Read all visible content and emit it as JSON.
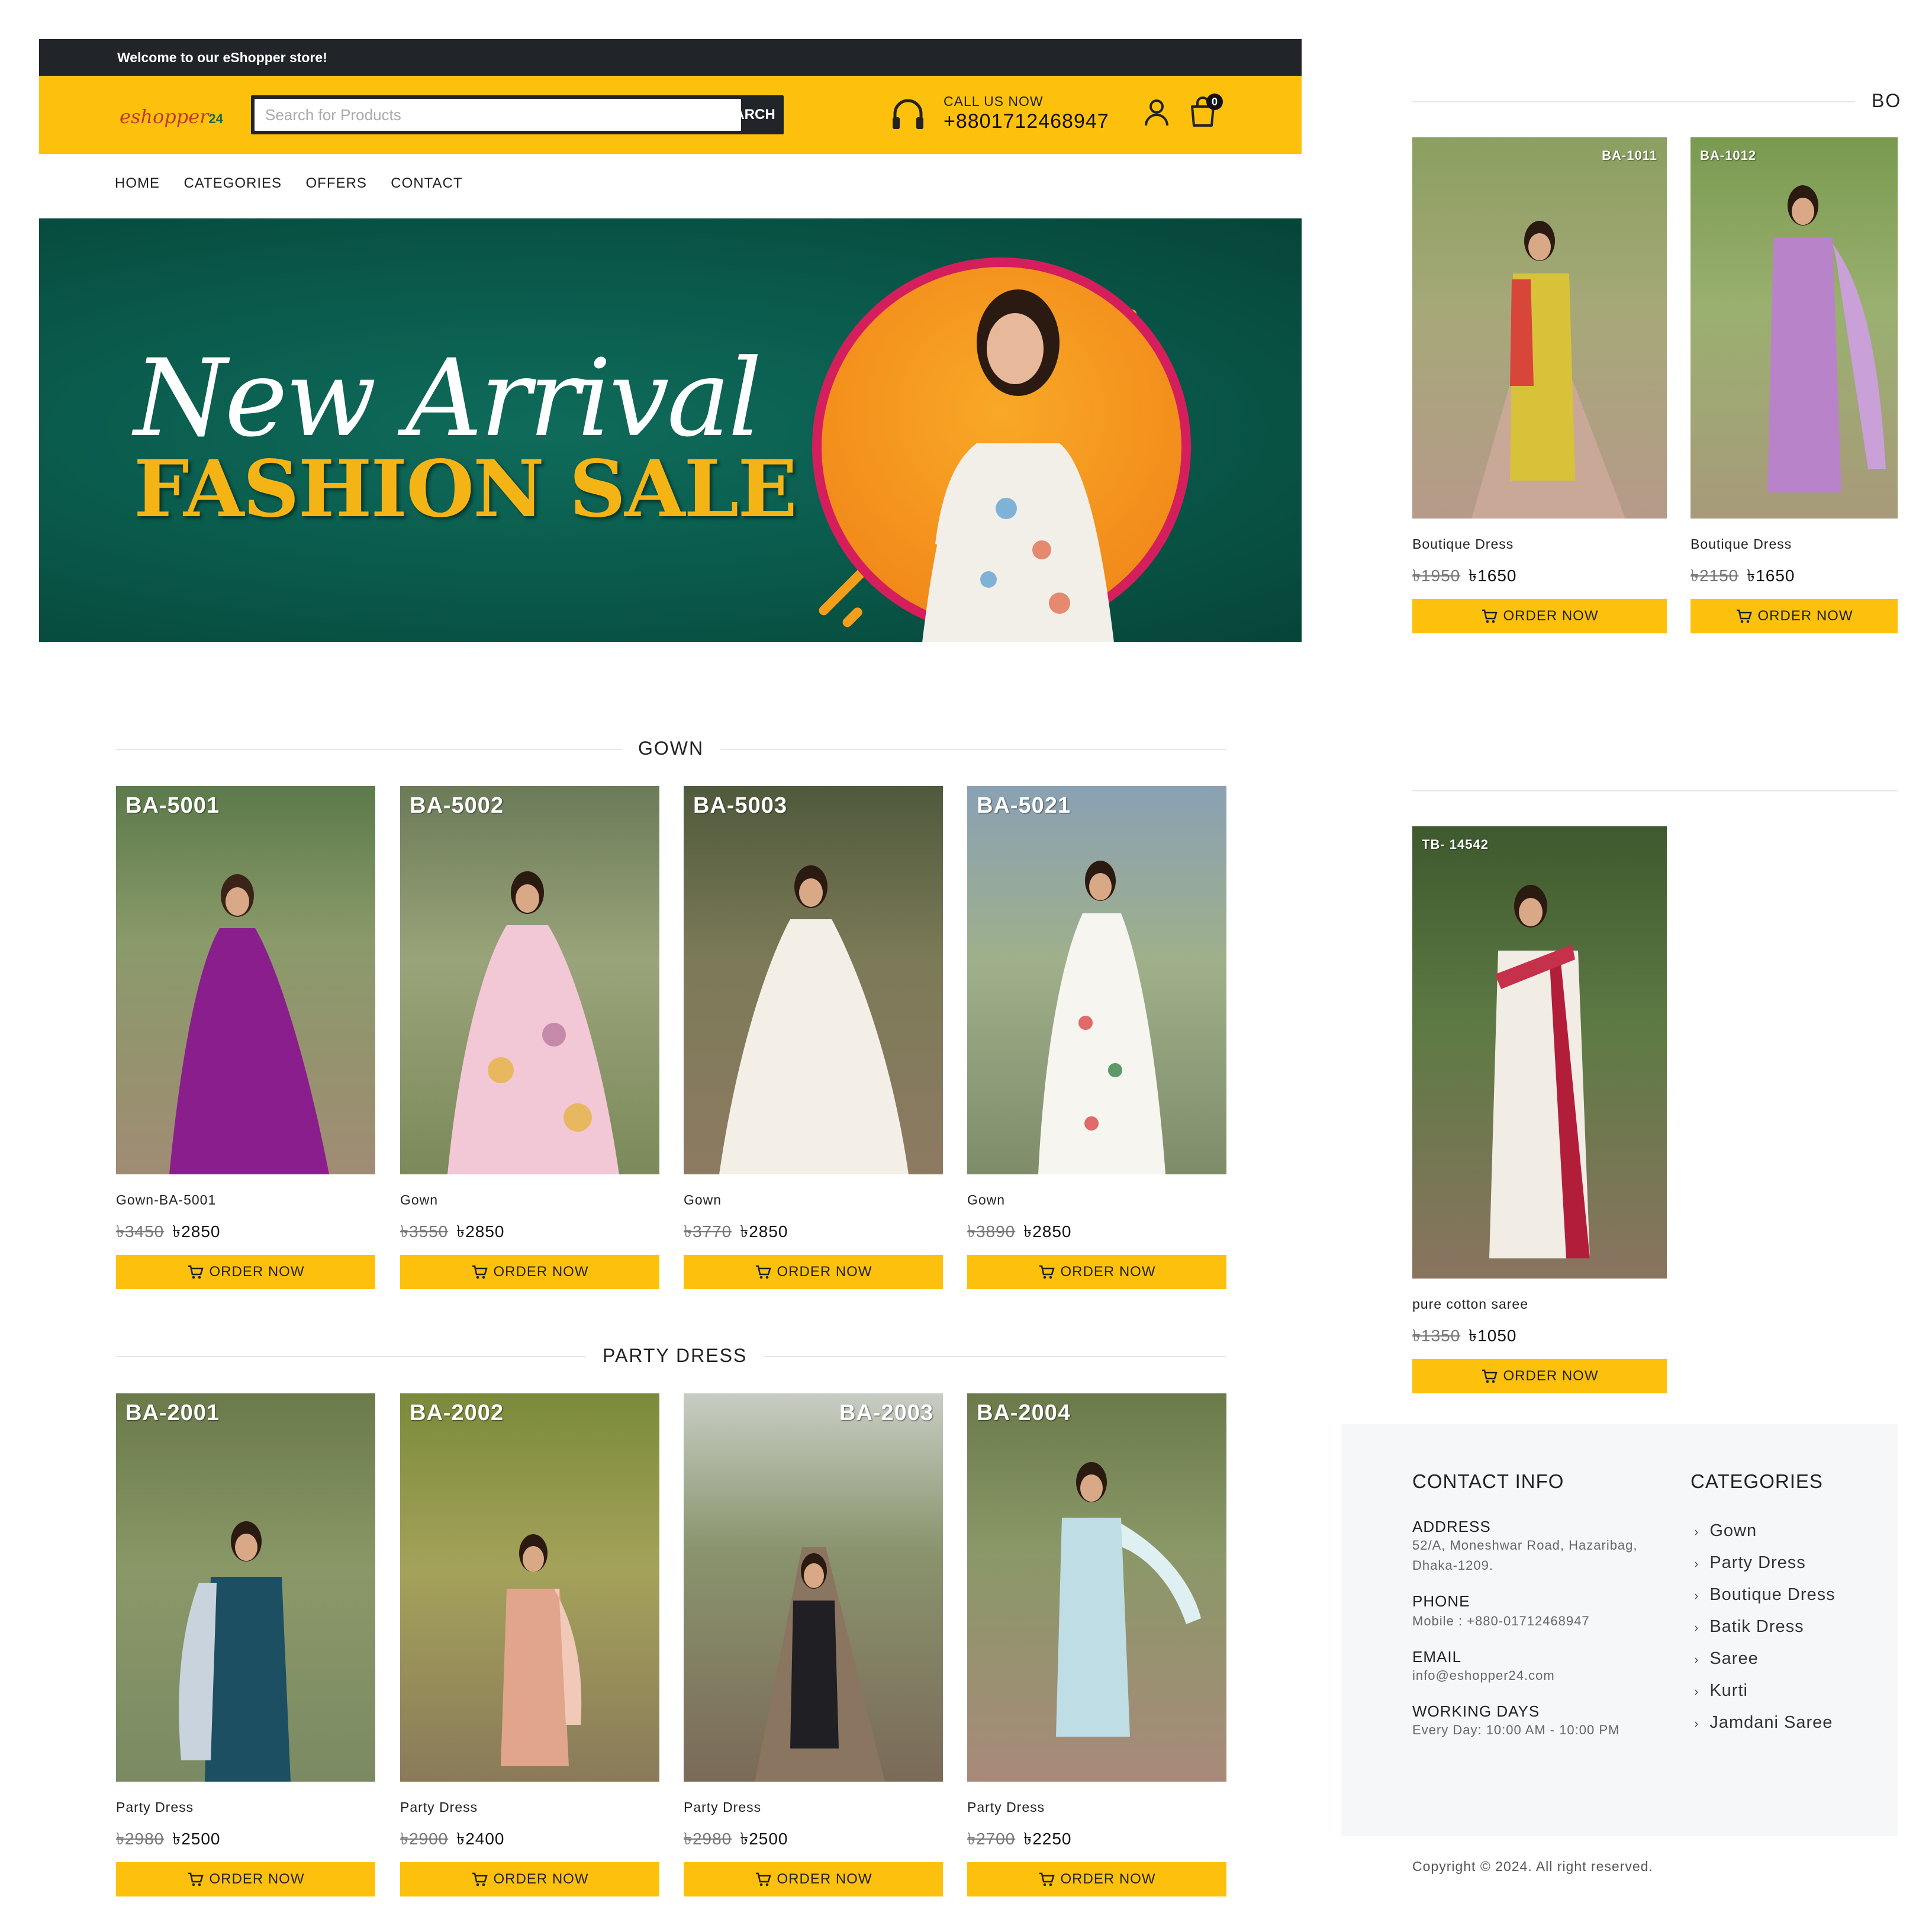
{
  "topbar": {
    "welcome": "Welcome to our eShopper store!"
  },
  "header": {
    "logo_text": "eshopper",
    "logo_suffix": "24",
    "search_placeholder": "Search for Products",
    "search_button": "SEARCH",
    "call_label": "CALL US NOW",
    "call_number": "+8801712468947",
    "cart_count": "0"
  },
  "nav": {
    "items": [
      "HOME",
      "CATEGORIES",
      "OFFERS",
      "CONTACT"
    ]
  },
  "banner": {
    "script_text": "New Arrival",
    "sale_text": "FASHION SALE"
  },
  "gown": {
    "title": "GOWN",
    "products": [
      {
        "code": "BA-5001",
        "name": "Gown-BA-5001",
        "old_price": "৳3450",
        "new_price": "৳2850",
        "button": "ORDER NOW"
      },
      {
        "code": "BA-5002",
        "name": "Gown",
        "old_price": "৳3550",
        "new_price": "৳2850",
        "button": "ORDER NOW"
      },
      {
        "code": "BA-5003",
        "name": "Gown",
        "old_price": "৳3770",
        "new_price": "৳2850",
        "button": "ORDER NOW"
      },
      {
        "code": "BA-5021",
        "name": "Gown",
        "old_price": "৳3890",
        "new_price": "৳2850",
        "button": "ORDER NOW"
      }
    ]
  },
  "party": {
    "title": "PARTY DRESS",
    "products": [
      {
        "code": "BA-2001",
        "name": "Party Dress",
        "old_price": "৳2980",
        "new_price": "৳2500",
        "button": "ORDER NOW"
      },
      {
        "code": "BA-2002",
        "name": "Party Dress",
        "old_price": "৳2900",
        "new_price": "৳2400",
        "button": "ORDER NOW"
      },
      {
        "code": "BA-2003",
        "name": "Party Dress",
        "old_price": "৳2980",
        "new_price": "৳2500",
        "button": "ORDER NOW"
      },
      {
        "code": "BA-2004",
        "name": "Party Dress",
        "old_price": "৳2700",
        "new_price": "৳2250",
        "button": "ORDER NOW"
      }
    ]
  },
  "boutique": {
    "title": "BO",
    "products": [
      {
        "code": "BA-1011",
        "name": "Boutique Dress",
        "old_price": "৳1950",
        "new_price": "৳1650",
        "button": "ORDER NOW"
      },
      {
        "code": "BA-1012",
        "name": "Boutique Dress",
        "old_price": "৳2150",
        "new_price": "৳1650",
        "button": "ORDER NOW"
      }
    ]
  },
  "saree": {
    "products": [
      {
        "code": "TB- 14542",
        "name": "pure cotton saree",
        "old_price": "৳1350",
        "new_price": "৳1050",
        "button": "ORDER NOW"
      }
    ]
  },
  "footer": {
    "contact_title": "CONTACT INFO",
    "address_label": "ADDRESS",
    "address_line1": "52/A, Moneshwar Road, Hazaribag,",
    "address_line2": "Dhaka-1209.",
    "phone_label": "PHONE",
    "phone_value": "Mobile : +880-01712468947",
    "email_label": "EMAIL",
    "email_value": "info@eshopper24.com",
    "days_label": "WORKING DAYS",
    "days_value": "Every Day: 10:00 AM - 10:00 PM",
    "categories_title": "CATEGORIES",
    "categories": [
      "Gown",
      "Party Dress",
      "Boutique Dress",
      "Batik Dress",
      "Saree",
      "Kurti",
      "Jamdani Saree"
    ],
    "copyright": "Copyright © 2024. All right reserved."
  },
  "colors": {
    "accent": "#fdc10d",
    "dark": "#212529",
    "banner_green": "#0a5c4d",
    "banner_ring": "#d51e5c"
  }
}
